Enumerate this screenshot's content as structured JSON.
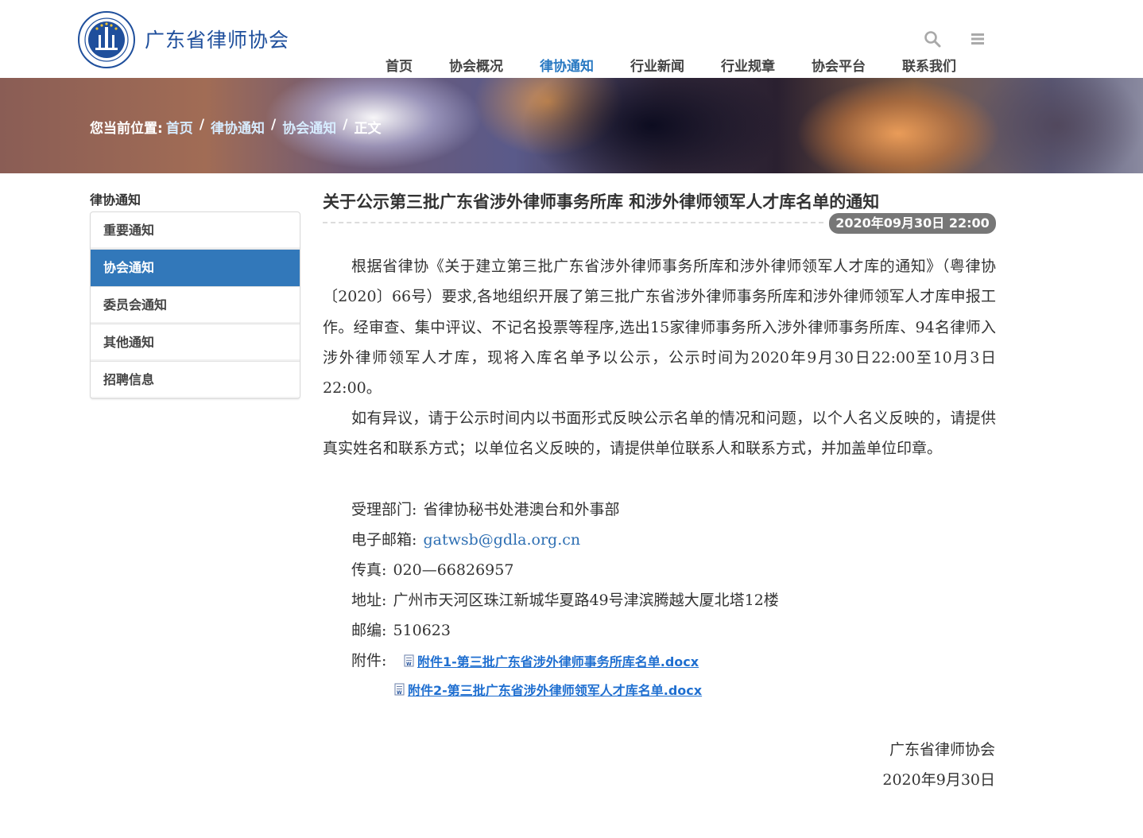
{
  "header": {
    "site_title": "广东省律师协会",
    "logo_text": "广东省律师协会 GUANGDONG LAWYERS ASSOCIATION",
    "nav": [
      {
        "label": "首页"
      },
      {
        "label": "协会概况"
      },
      {
        "label": "律协通知",
        "active": true
      },
      {
        "label": "行业新闻"
      },
      {
        "label": "行业规章"
      },
      {
        "label": "协会平台"
      },
      {
        "label": "联系我们"
      }
    ],
    "icons": {
      "search": "search-icon",
      "menu": "menu-icon"
    }
  },
  "breadcrumb": {
    "prefix": "您当前位置:",
    "items": [
      "首页",
      "律协通知",
      "协会通知",
      "正文"
    ],
    "separator": "/"
  },
  "sidebar": {
    "title": "律协通知",
    "items": [
      {
        "label": "重要通知"
      },
      {
        "label": "协会通知",
        "active": true
      },
      {
        "label": "委员会通知"
      },
      {
        "label": "其他通知"
      },
      {
        "label": "招聘信息"
      }
    ]
  },
  "article": {
    "title": "关于公示第三批广东省涉外律师事务所库 和涉外律师领军人才库名单的通知",
    "date": "2020年09月30日 22:00",
    "paragraphs": [
      "根据省律协《关于建立第三批广东省涉外律师事务所库和涉外律师领军人才库的通知》（粤律协〔2020〕66号）要求,各地组织开展了第三批广东省涉外律师事务所库和涉外律师领军人才库申报工作。经审查、集中评议、不记名投票等程序,选出15家律师事务所入涉外律师事务所库、94名律师入涉外律师领军人才库，现将入库名单予以公示，公示时间为2020年9月30日22:00至10月3日22:00。",
      "如有异议，请于公示时间内以书面形式反映公示名单的情况和问题，以个人名义反映的，请提供真实姓名和联系方式；以单位名义反映的，请提供单位联系人和联系方式，并加盖单位印章。"
    ],
    "contact": {
      "dept_label": "受理部门:",
      "dept": "省律协秘书处港澳台和外事部",
      "email_label": "电子邮箱:",
      "email": "gatwsb@gdla.org.cn",
      "fax_label": "传真:",
      "fax": "020—66826957",
      "address_label": "地址:",
      "address": "广州市天河区珠江新城华夏路49号津滨腾越大厦北塔12楼",
      "zip_label": "邮编:",
      "zip": "510623"
    },
    "attachments_label": "附件:",
    "attachments": [
      "附件1-第三批广东省涉外律师事务所库名单.docx",
      "附件2-第三批广东省涉外律师领军人才库名单.docx"
    ],
    "signature": {
      "org": "广东省律师协会",
      "date": "2020年9月30日"
    }
  },
  "colors": {
    "brand_blue": "#1f4f9c",
    "accent_blue": "#2979c2",
    "sidebar_active": "#3278ba",
    "link_blue": "#1f6fd0",
    "date_badge": "#777777"
  }
}
